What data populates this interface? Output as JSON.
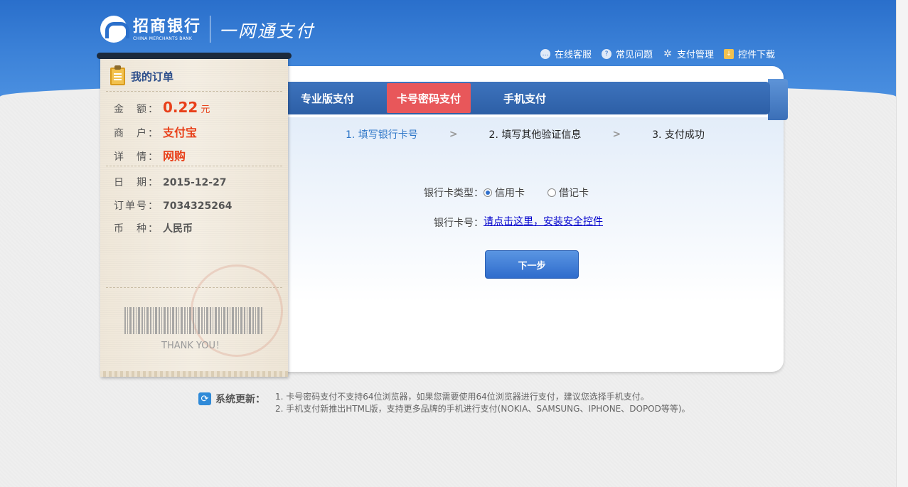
{
  "header": {
    "bank_cn": "招商银行",
    "bank_en": "CHINA MERCHANTS BANK",
    "product": "一网通支付",
    "links": [
      {
        "label": "在线客服",
        "icon": "chat-icon"
      },
      {
        "label": "常见问题",
        "icon": "help-icon"
      },
      {
        "label": "支付管理",
        "icon": "gear-icon"
      },
      {
        "label": "控件下载",
        "icon": "download-icon"
      }
    ]
  },
  "tabs": [
    {
      "label": "专业版支付",
      "active": false
    },
    {
      "label": "卡号密码支付",
      "active": true
    },
    {
      "label": "手机支付",
      "active": false
    }
  ],
  "steps": [
    {
      "label": "1. 填写银行卡号",
      "current": true
    },
    {
      "label": "2. 填写其他验证信息",
      "current": false
    },
    {
      "label": "3. 支付成功",
      "current": false
    }
  ],
  "form": {
    "card_type_label": "银行卡类型：",
    "card_type_options": [
      {
        "label": "信用卡",
        "checked": true
      },
      {
        "label": "借记卡",
        "checked": false
      }
    ],
    "card_no_label": "银行卡号：",
    "install_link": "请点击这里，安装安全控件",
    "next_button": "下一步"
  },
  "order": {
    "title": "我的订单",
    "amount_label": "金　额：",
    "amount_value": "0.22",
    "amount_unit": "元",
    "merchant_label": "商　户：",
    "merchant_value": "支付宝",
    "detail_label": "详　情：",
    "detail_value": "网购",
    "date_label": "日　期：",
    "date_value": "2015-12-27",
    "order_no_label": "订单号：",
    "order_no_value": "7034325264",
    "currency_label": "币　种：",
    "currency_value": "人民币",
    "thanks": "THANK YOU！"
  },
  "system_update": {
    "title": "系统更新：",
    "notes": [
      "1. 卡号密码支付不支持64位浏览器，如果您需要使用64位浏览器进行支付，建议您选择手机支付。",
      "2. 手机支付新推出HTML版，支持更多品牌的手机进行支付(NOKIA、SAMSUNG、IPHONE、DOPOD等等)。"
    ]
  }
}
